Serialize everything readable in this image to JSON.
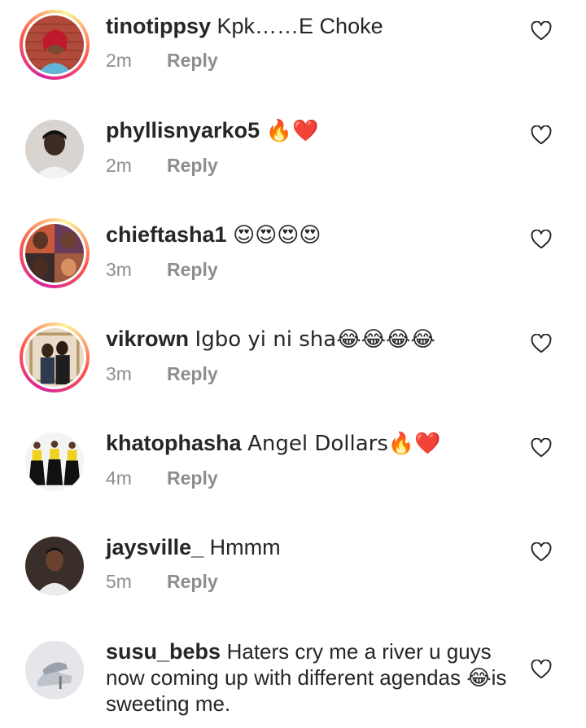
{
  "comments": [
    {
      "username": "tinotippsy",
      "text": "Kpk……E Choke",
      "time": "2m",
      "reply": "Reply",
      "avatar": "woman-red-hair-brick-wall",
      "story_ring": true
    },
    {
      "username": "phyllisnyarko5",
      "text": "🔥❤️",
      "time": "2m",
      "reply": "Reply",
      "avatar": "person-selfie",
      "story_ring": false
    },
    {
      "username": "chieftasha1",
      "text": "😍😍😍😍",
      "time": "3m",
      "reply": "Reply",
      "avatar": "collage-women",
      "story_ring": true
    },
    {
      "username": "vikrown",
      "text": "Igbo yi ni sha😂😂😂😂",
      "time": "3m",
      "reply": "Reply",
      "avatar": "couple-photo",
      "story_ring": true
    },
    {
      "username": "khatophasha",
      "text": "Angel Dollars🔥❤️",
      "time": "4m",
      "reply": "Reply",
      "avatar": "group-dancers",
      "story_ring": false
    },
    {
      "username": "jaysville_",
      "text": "Hmmm",
      "time": "5m",
      "reply": "Reply",
      "avatar": "man-portrait",
      "story_ring": false
    },
    {
      "username": "susu_bebs",
      "text": "Haters cry me a river u guys now coming up with different agendas 😂is sweeting me.",
      "time": "",
      "reply": "",
      "avatar": "shoes-photo",
      "story_ring": false
    }
  ],
  "icons": {
    "like": "heart-outline-icon"
  },
  "colors": {
    "text": "#262626",
    "meta": "#8e8e8e",
    "heart": "#262626"
  }
}
